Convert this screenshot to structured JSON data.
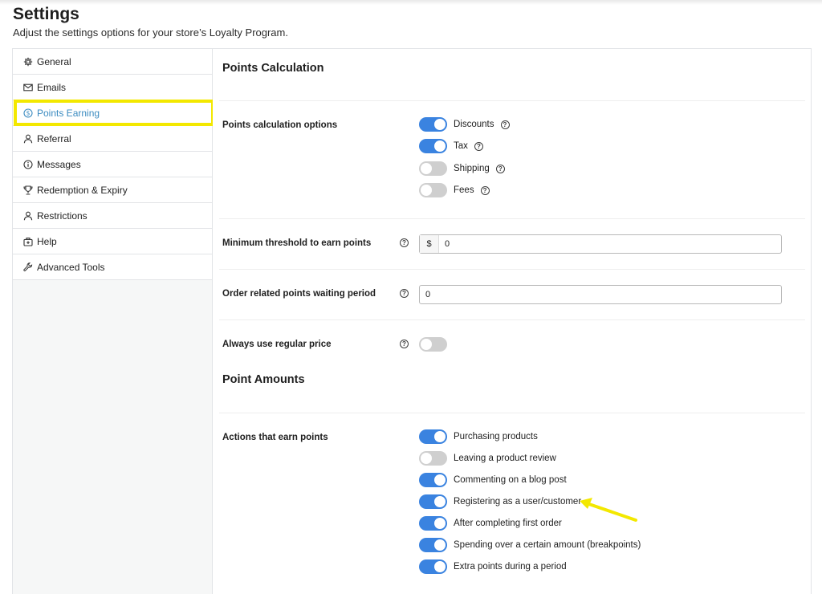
{
  "page": {
    "title": "Settings",
    "subtitle": "Adjust the settings options for your store’s Loyalty Program."
  },
  "sidebar": {
    "items": [
      {
        "label": "General",
        "icon": "gear-icon"
      },
      {
        "label": "Emails",
        "icon": "envelope-icon"
      },
      {
        "label": "Points Earning",
        "icon": "dollar-circle-icon",
        "active": true
      },
      {
        "label": "Referral",
        "icon": "user-icon"
      },
      {
        "label": "Messages",
        "icon": "info-circle-icon"
      },
      {
        "label": "Redemption & Expiry",
        "icon": "trophy-icon"
      },
      {
        "label": "Restrictions",
        "icon": "user-icon"
      },
      {
        "label": "Help",
        "icon": "lifebuoy-icon"
      },
      {
        "label": "Advanced Tools",
        "icon": "wrench-icon"
      }
    ]
  },
  "points_calculation": {
    "title": "Points Calculation",
    "options_label": "Points calculation options",
    "options": [
      {
        "label": "Discounts",
        "on": true
      },
      {
        "label": "Tax",
        "on": true
      },
      {
        "label": "Shipping",
        "on": false
      },
      {
        "label": "Fees",
        "on": false
      }
    ],
    "threshold_label": "Minimum threshold to earn points",
    "threshold_prefix": "$",
    "threshold_value": "0",
    "waiting_label": "Order related points waiting period",
    "waiting_value": "0",
    "regular_price_label": "Always use regular price",
    "regular_price_on": false
  },
  "point_amounts": {
    "title": "Point Amounts",
    "actions_label": "Actions that earn points",
    "actions": [
      {
        "label": "Purchasing products",
        "on": true
      },
      {
        "label": "Leaving a product review",
        "on": false
      },
      {
        "label": "Commenting on a blog post",
        "on": true
      },
      {
        "label": "Registering as a user/customer",
        "on": true
      },
      {
        "label": "After completing first order",
        "on": true
      },
      {
        "label": "Spending over a certain amount (breakpoints)",
        "on": true
      },
      {
        "label": "Extra points during a period",
        "on": true
      }
    ]
  },
  "colors": {
    "accent": "#3a83e0",
    "active_nav": "#3b8bc0",
    "highlight": "#f3e800",
    "toggle_off": "#cfcfcf"
  }
}
